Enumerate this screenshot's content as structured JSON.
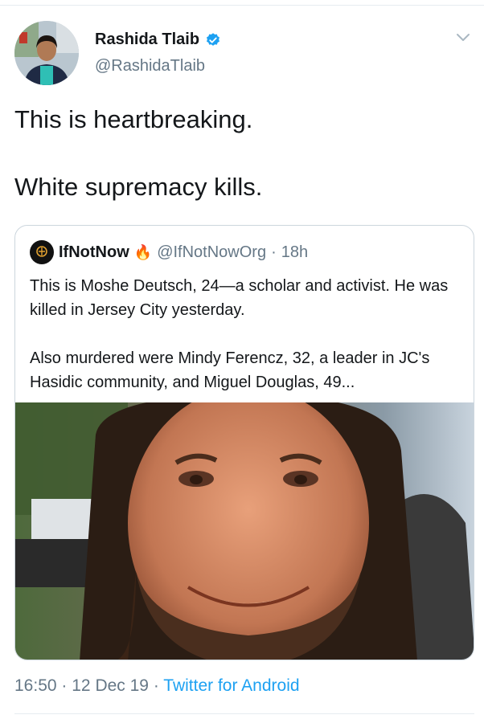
{
  "tweet": {
    "author": {
      "name": "Rashida Tlaib",
      "handle": "@RashidaTlaib",
      "verified": true
    },
    "text": [
      "This is heartbreaking.",
      "White supremacy kills."
    ],
    "quoted": {
      "author": {
        "name": "IfNotNow",
        "emoji": "🔥",
        "handle": "@IfNotNowOrg",
        "separator": "·",
        "time": "18h"
      },
      "text": [
        "This is Moshe Deutsch, 24—a scholar and activist. He was killed in Jersey City yesterday.",
        "Also murdered were Mindy Ferencz, 32, a leader in JC's Hasidic community, and Miguel Douglas, 49..."
      ],
      "media": "photo"
    },
    "meta": {
      "time": "16:50",
      "separator": "·",
      "date": "12 Dec 19",
      "source": "Twitter for Android"
    }
  },
  "colors": {
    "accent": "#1da1f2",
    "secondary_text": "#657786",
    "primary_text": "#14171a",
    "border": "#ccd6dd"
  },
  "icons": [
    "verified-badge-icon",
    "chevron-down-icon",
    "fire-icon"
  ]
}
